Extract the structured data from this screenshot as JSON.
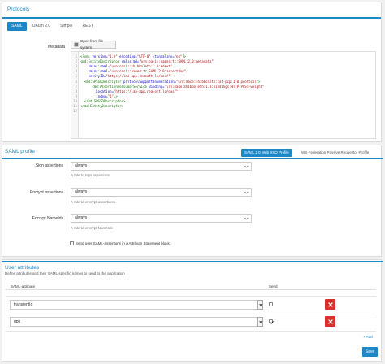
{
  "protocols": {
    "title": "Protocols",
    "tabs": [
      {
        "label": "SAML",
        "active": true
      },
      {
        "label": "OAuth 2.0",
        "active": false
      },
      {
        "label": "Simple",
        "active": false
      },
      {
        "label": "REST",
        "active": false
      }
    ],
    "metadata_label": "Metadata",
    "open_file_label": "Open from file system",
    "code_lines": [
      {
        "n": "1",
        "parts": [
          [
            "t",
            "<?xml "
          ],
          [
            "a",
            "version="
          ],
          [
            "s",
            "\"1.0\" "
          ],
          [
            "a",
            "encoding="
          ],
          [
            "s",
            "\"UTF-8\" "
          ],
          [
            "a",
            "standalone="
          ],
          [
            "s",
            "\"no\""
          ],
          [
            "t",
            "?>"
          ]
        ]
      },
      {
        "n": "2",
        "parts": [
          [
            "t",
            "<md:EntityDescriptor "
          ],
          [
            "a",
            "xmlns:md="
          ],
          [
            "s",
            "\"urn:oasis:names:tc:SAML:2.0:metadata\""
          ]
        ]
      },
      {
        "n": "3",
        "parts": [
          [
            "t",
            "    "
          ],
          [
            "a",
            "xmlns:saml="
          ],
          [
            "s",
            "\"urn:oasis:shibboleth:2.0:mdext\""
          ]
        ]
      },
      {
        "n": "4",
        "parts": [
          [
            "t",
            "    "
          ],
          [
            "a",
            "xmlns:saml="
          ],
          [
            "s",
            "\"urn:oasis:names:tc:SAML:2.0:assertion\""
          ]
        ]
      },
      {
        "n": "5",
        "parts": [
          [
            "t",
            "    "
          ],
          [
            "a",
            "entityID="
          ],
          [
            "s",
            "\"https://lab-app.reasoft.lo/oas/\""
          ],
          [
            "t",
            ">"
          ]
        ]
      },
      {
        "n": "6",
        "parts": [
          [
            "t",
            "  <md:SPSSODescriptor "
          ],
          [
            "a",
            "protocolSupportEnumeration="
          ],
          [
            "s",
            "\"urn:mace:shibboleth:saf-pcp:1.0:protocol\""
          ],
          [
            "t",
            ">"
          ]
        ]
      },
      {
        "n": "7",
        "parts": [
          [
            "t",
            "      <md:AssertionConsumerService "
          ],
          [
            "a",
            "Binding="
          ],
          [
            "s",
            "\"urn:mace:shibboleth:1.0:bindings:HTTP-POST-weight\""
          ]
        ]
      },
      {
        "n": "8",
        "parts": [
          [
            "t",
            "        "
          ],
          [
            "a",
            "Location="
          ],
          [
            "s",
            "\"https://lab-app.reasoft.lo/oas/\""
          ]
        ]
      },
      {
        "n": "9",
        "parts": [
          [
            "t",
            "        "
          ],
          [
            "a",
            "index="
          ],
          [
            "s",
            "\"1\""
          ],
          [
            "t",
            "/>"
          ]
        ]
      },
      {
        "n": "10",
        "parts": [
          [
            "t",
            "  </md:SPSSODescriptor>"
          ]
        ]
      },
      {
        "n": "11",
        "parts": [
          [
            "t",
            "</md:EntityDescriptor>"
          ]
        ]
      },
      {
        "n": "12",
        "parts": [
          [
            "t",
            ""
          ]
        ]
      }
    ]
  },
  "saml_profile": {
    "title": "SAML profile",
    "tab_web_sso": "SAML 2.0 Web SSO Profile",
    "tab_ws_fed": "WS-Federation Passive Requestor Profile",
    "sign_label": "Sign assertions",
    "sign_value": "always",
    "sign_help": "A rule to sign assertions",
    "encrypt_label": "Encrypt assertions",
    "encrypt_value": "always",
    "encrypt_help": "A rule to encrypt assertions",
    "nameids_label": "Encrypt NameIds",
    "nameids_value": "always",
    "nameids_help": "A rule to encrypt NameIds",
    "statement_label": "Send user SAML-assertions in a Attribute Statement block",
    "statement_checked": false
  },
  "user_attributes": {
    "title": "User attributes",
    "description": "Define attributes and their SAML-specific names to send to the application",
    "col_attr": "SAML-attribute",
    "col_send": "Send",
    "rows": [
      {
        "value": "transientId",
        "send": false
      },
      {
        "value": "upn",
        "send": true
      }
    ],
    "add_label": "+ Add",
    "save_label": "Save"
  },
  "colors": {
    "accent": "#1e88c7",
    "danger": "#d9302d"
  }
}
